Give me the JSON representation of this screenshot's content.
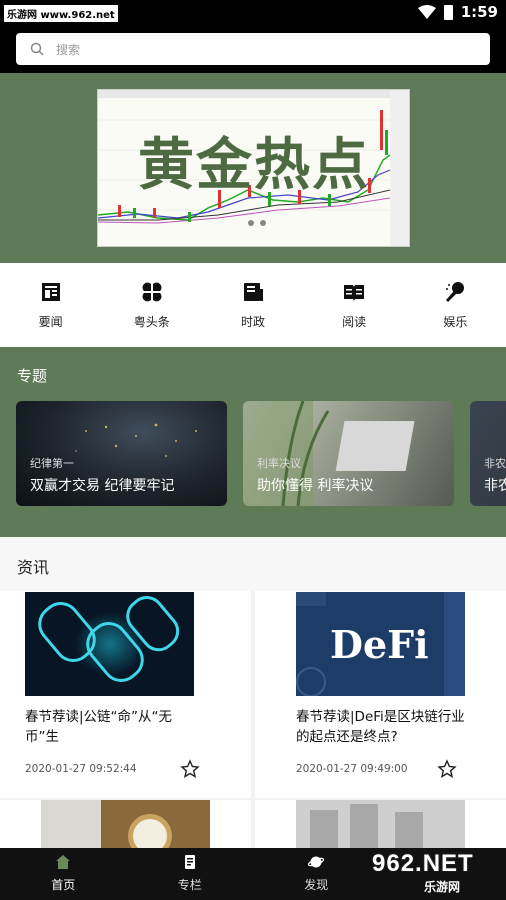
{
  "status_bar": {
    "site": "乐游网 www.962.net",
    "time": "1:59"
  },
  "search": {
    "placeholder": "搜索"
  },
  "banner": {
    "title": "黄金热点"
  },
  "nav_items": [
    {
      "label": "要闻",
      "icon": "newspaper-icon"
    },
    {
      "label": "粤头条",
      "icon": "clover-icon"
    },
    {
      "label": "时政",
      "icon": "book-mark-icon"
    },
    {
      "label": "阅读",
      "icon": "open-book-icon"
    },
    {
      "label": "娱乐",
      "icon": "microphone-icon"
    }
  ],
  "topics": {
    "title": "专题",
    "cards": [
      {
        "category": "纪律第一",
        "title": "双赢才交易 纪律要牢记"
      },
      {
        "category": "利率决议",
        "title": "助你懂得 利率决议"
      },
      {
        "category": "非农",
        "title": "非农"
      }
    ]
  },
  "news": {
    "title": "资讯",
    "items": [
      {
        "headline": "春节荐读|公链“命”从“无币”生",
        "date": "2020-01-27 09:52:44"
      },
      {
        "headline": "春节荐读|DeFi是区块链行业的起点还是终点?",
        "date": "2020-01-27 09:49:00",
        "thumb_text": "DeFi"
      }
    ]
  },
  "tabs": [
    {
      "label": "首页",
      "icon": "home-icon"
    },
    {
      "label": "专栏",
      "icon": "document-icon"
    },
    {
      "label": "发现",
      "icon": "planet-icon"
    },
    {
      "label": "",
      "icon": ""
    }
  ],
  "watermark": {
    "big": "962.NET",
    "small": "乐游网"
  },
  "colors": {
    "accent": "#5f7a56",
    "header": "#000000",
    "tabbar": "#111111"
  }
}
